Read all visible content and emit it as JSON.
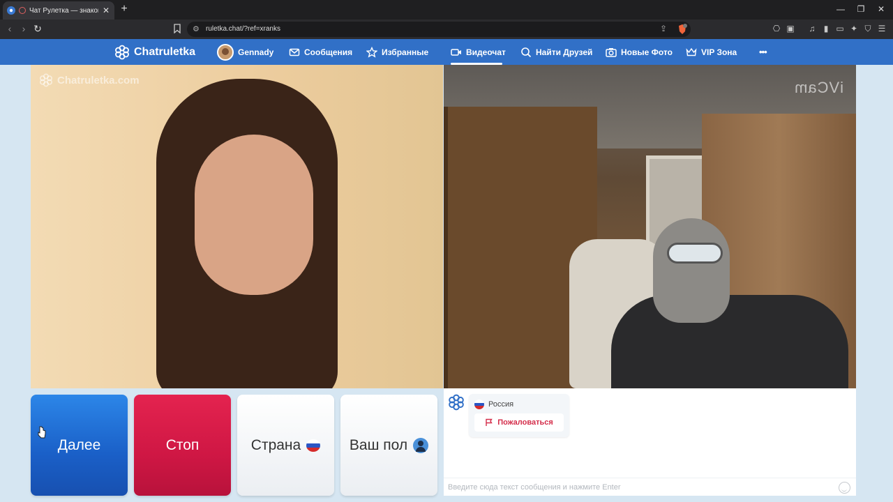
{
  "browser": {
    "tab_title": "Чат Рулетка — знакомства и",
    "tab_close": "✕",
    "new_tab": "+",
    "url": "ruletka.chat/?ref=xranks",
    "window_controls": {
      "minimize": "—",
      "maximize": "❐",
      "close": "✕"
    },
    "nav": {
      "back": "‹",
      "forward": "›",
      "reload": "↻"
    },
    "share_icon": "⇪",
    "extensions": [
      "⎔",
      "▣",
      "♫",
      "▮",
      "▭",
      "✦",
      "⛉",
      "☰"
    ]
  },
  "site_nav": {
    "logo": "Chatruletka",
    "user": "Gennady",
    "items": [
      {
        "label": "Сообщения",
        "icon": "mail-icon"
      },
      {
        "label": "Избранные",
        "icon": "star-icon"
      },
      {
        "label": "Видеочат",
        "icon": "video-camera-icon",
        "active": true
      },
      {
        "label": "Найти Друзей",
        "icon": "search-icon"
      },
      {
        "label": "Новые Фото",
        "icon": "camera-icon"
      },
      {
        "label": "VIP Зона",
        "icon": "crown-icon"
      }
    ],
    "more": "•••"
  },
  "video": {
    "watermark": "Chatruletka.com",
    "partner_watermark": "iVCam"
  },
  "controls": {
    "next": "Далее",
    "stop": "Стоп",
    "country": "Страна",
    "gender": "Ваш пол"
  },
  "chat": {
    "country": "Россия",
    "report": "Пожаловаться",
    "input_placeholder": "Введите сюда текст сообщения и нажмите Enter"
  },
  "colors": {
    "nav_blue": "#3170c7",
    "next_blue": "#1a5fc7",
    "stop_red": "#cf1744",
    "report_red": "#d42d4a"
  }
}
